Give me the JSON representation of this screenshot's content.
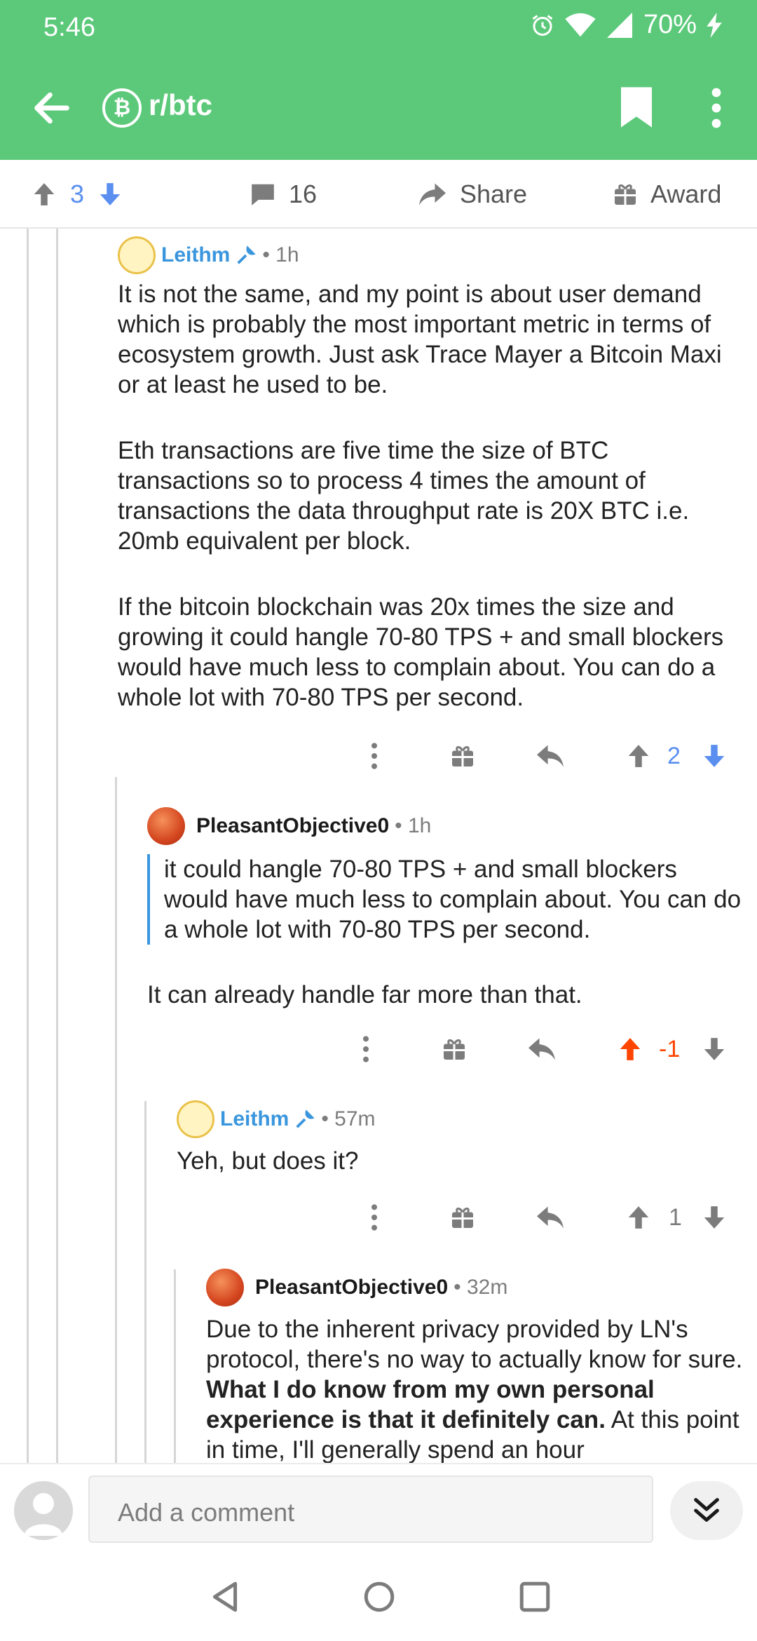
{
  "status_bar": {
    "time": "5:46",
    "battery": "70%"
  },
  "app_bar": {
    "subreddit": "r/btc",
    "sub_icon": "₿"
  },
  "post_actions": {
    "score": "3",
    "comments": "16",
    "share": "Share",
    "award": "Award"
  },
  "comments": [
    {
      "author": "Leithm",
      "time": "• 1h",
      "paragraphs": [
        "It is not the same, and my point is about user demand which is probably the most important metric in terms of ecosystem growth.  Just ask Trace Mayer a Bitcoin Maxi or at least he used to be.",
        "Eth transactions are five time the size of BTC transactions so to process 4 times the amount of transactions the data throughput rate is 20X BTC i.e. 20mb equivalent per block.",
        "If the bitcoin blockchain was 20x times the size and growing it could hangle 70-80 TPS + and small blockers would have much less to complain about. You can do a whole lot with 70-80 TPS per second."
      ],
      "score": "2"
    },
    {
      "author": "PleasantObjective0",
      "time": "• 1h",
      "quote": "it could hangle 70-80 TPS + and small blockers would have much less to complain about. You can do a whole lot with 70-80 TPS per second.",
      "text": "It can already handle far more than that.",
      "score": "-1"
    },
    {
      "author": "Leithm",
      "time": "• 57m",
      "text": "Yeh, but does it?",
      "score": "1"
    },
    {
      "author": "PleasantObjective0",
      "time": "• 32m",
      "text_start": "Due to the inherent privacy provided by LN's protocol, there's no way to actually know for sure.  ",
      "text_bold": "What I do know from my own personal experience is that it definitely can.",
      "text_end": "  At this point in time, I'll generally spend an hour"
    }
  ],
  "comment_bar": {
    "placeholder": "Add a comment"
  }
}
